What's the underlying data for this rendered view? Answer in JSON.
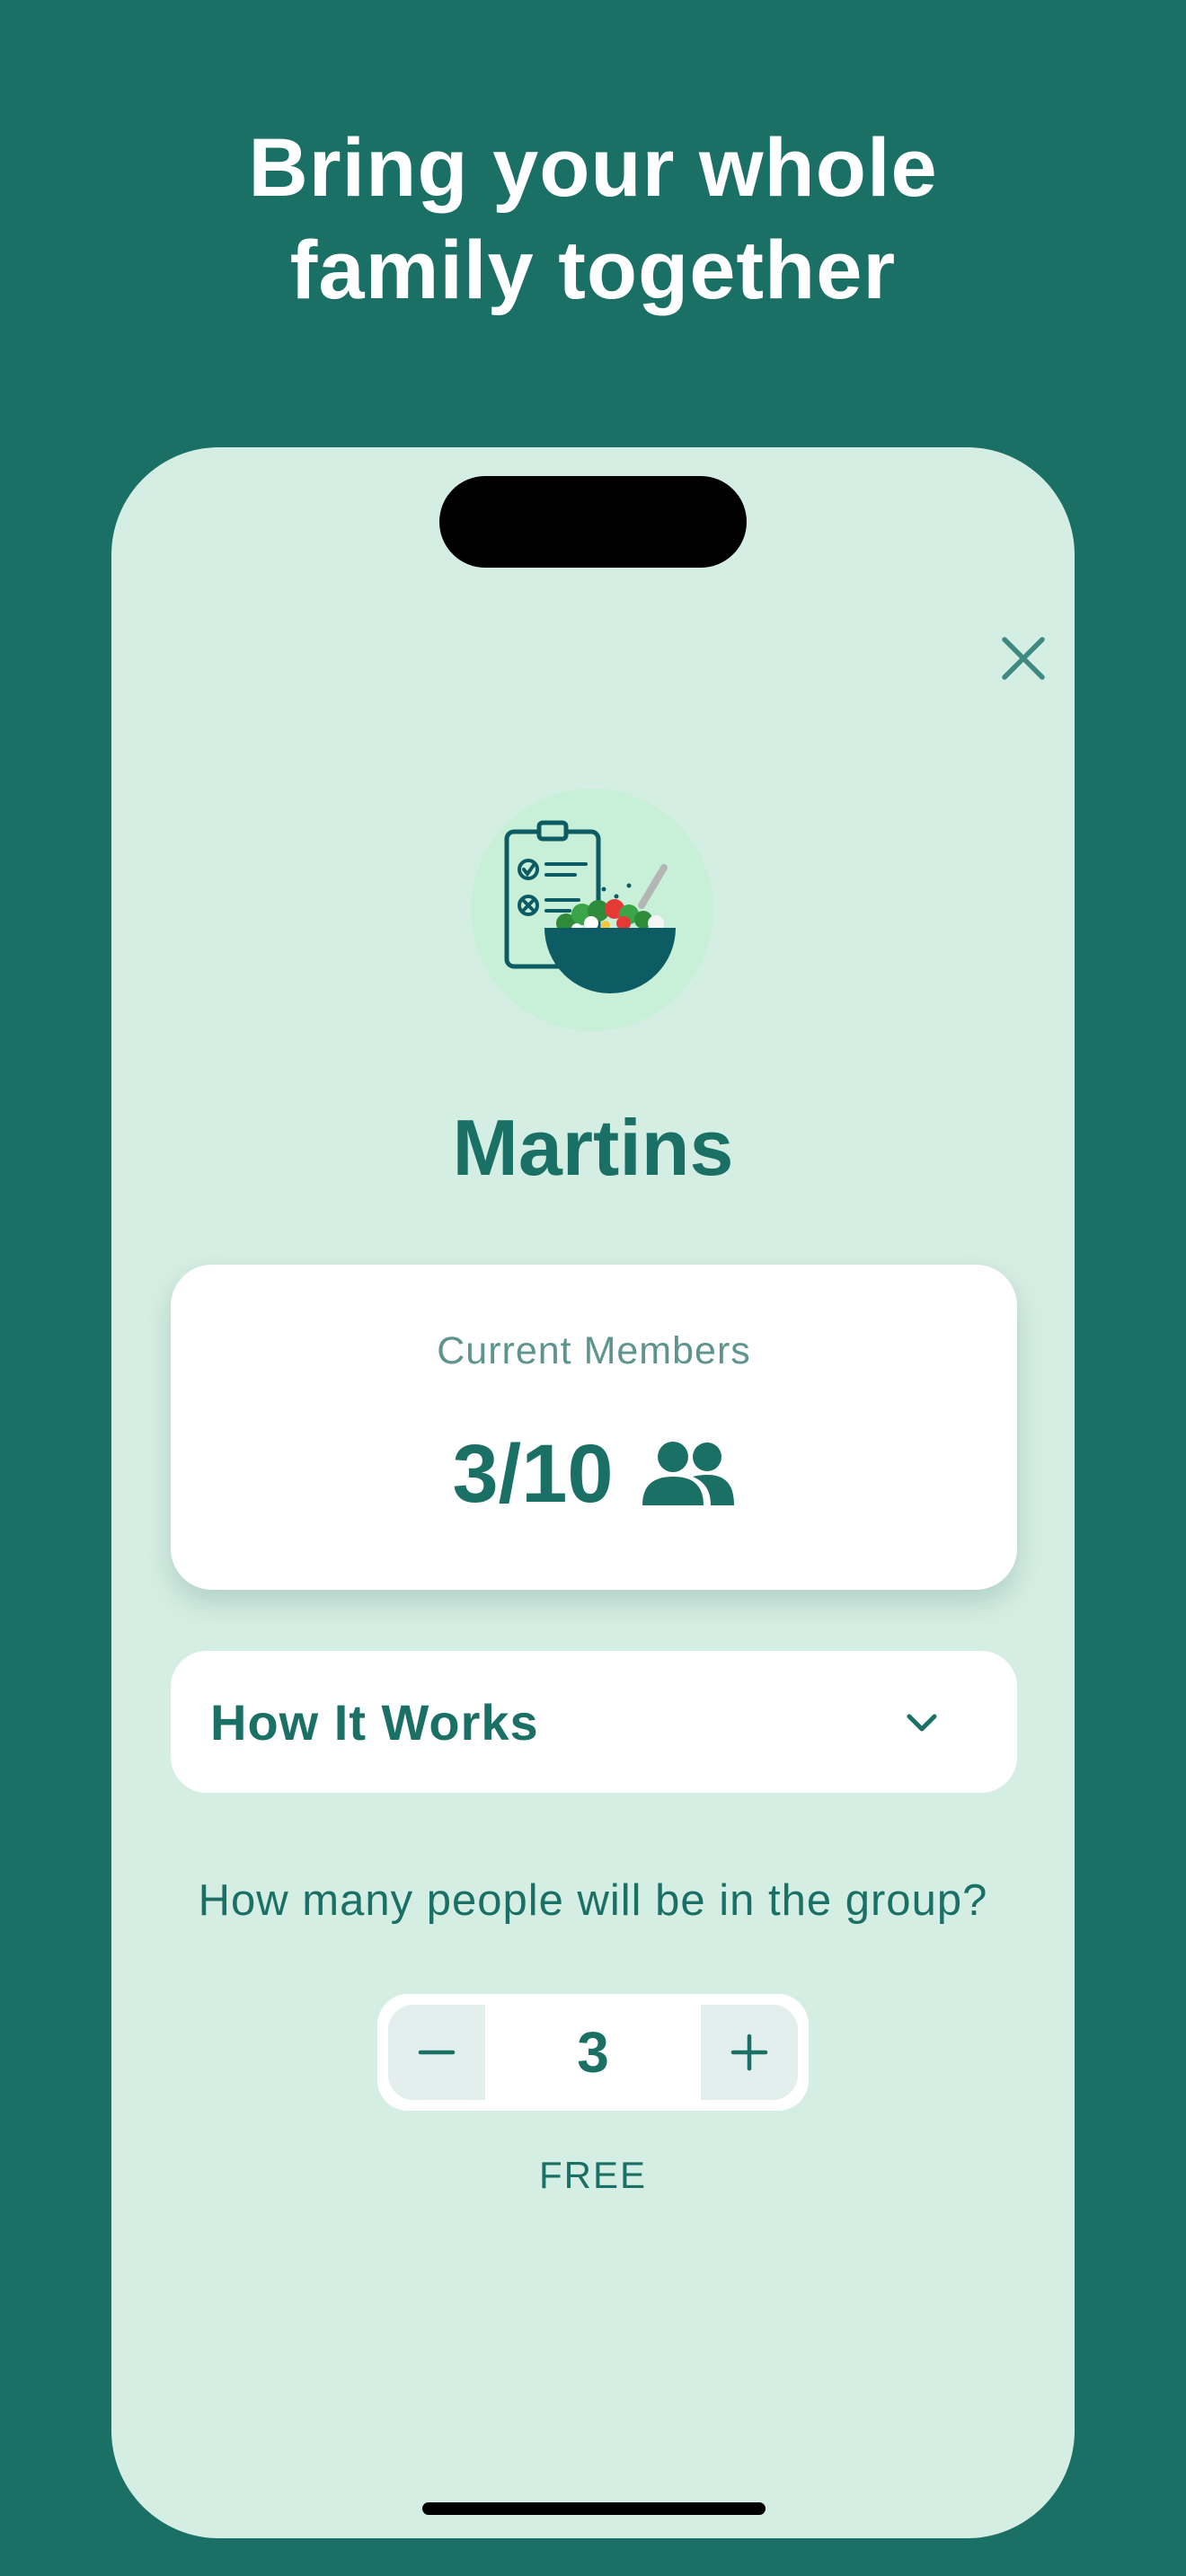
{
  "headline": {
    "line1": "Bring your whole",
    "line2": "family together"
  },
  "colors": {
    "background": "#1b7066",
    "screen": "#d5eee3",
    "accent": "#1b7066",
    "card": "#ffffff"
  },
  "icons": {
    "close": "close-icon",
    "hero": "meal-plan-illustration",
    "members": "people-icon",
    "expand": "chevron-down-icon",
    "decrement": "minus-icon",
    "increment": "plus-icon"
  },
  "group": {
    "name": "Martins"
  },
  "members": {
    "label": "Current Members",
    "count": "3/10"
  },
  "how_it_works": {
    "label": "How It Works",
    "expanded": false
  },
  "group_size": {
    "question": "How many people will be in the group?",
    "value": "3",
    "price": "FREE"
  }
}
